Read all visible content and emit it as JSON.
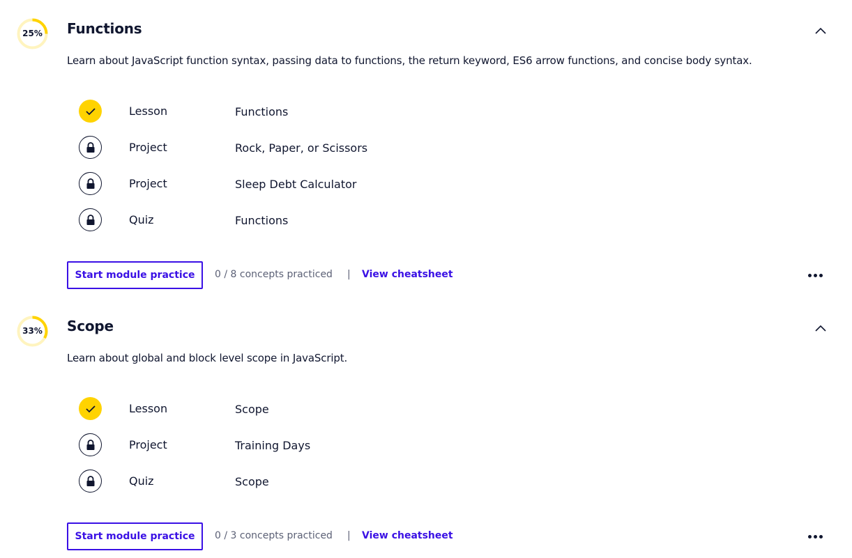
{
  "modules": [
    {
      "progress_percent": 25,
      "progress_label": "25%",
      "title": "Functions",
      "description": "Learn about JavaScript function syntax, passing data to functions, the return keyword, ES6 arrow functions, and concise body syntax.",
      "items": [
        {
          "status": "completed",
          "status_icon": "check-icon",
          "type": "Lesson",
          "name": "Functions"
        },
        {
          "status": "locked",
          "status_icon": "lock-icon",
          "type": "Project",
          "name": "Rock, Paper, or Scissors"
        },
        {
          "status": "locked",
          "status_icon": "lock-icon",
          "type": "Project",
          "name": "Sleep Debt Calculator"
        },
        {
          "status": "locked",
          "status_icon": "lock-icon",
          "type": "Quiz",
          "name": "Functions"
        }
      ],
      "practice_button": "Start module practice",
      "concepts_text": "0 / 8 concepts practiced",
      "separator": "|",
      "cheatsheet_link": "View cheatsheet"
    },
    {
      "progress_percent": 33,
      "progress_label": "33%",
      "title": "Scope",
      "description": "Learn about global and block level scope in JavaScript.",
      "items": [
        {
          "status": "completed",
          "status_icon": "check-icon",
          "type": "Lesson",
          "name": "Scope"
        },
        {
          "status": "locked",
          "status_icon": "lock-icon",
          "type": "Project",
          "name": "Training Days"
        },
        {
          "status": "locked",
          "status_icon": "lock-icon",
          "type": "Quiz",
          "name": "Scope"
        }
      ],
      "practice_button": "Start module practice",
      "concepts_text": "0 / 3 concepts practiced",
      "separator": "|",
      "cheatsheet_link": "View cheatsheet"
    }
  ],
  "colors": {
    "text": "#10162f",
    "accent": "#3a10e5",
    "progress": "#ffd300",
    "progress_track": "#fff4bf",
    "muted": "#5c6176"
  }
}
